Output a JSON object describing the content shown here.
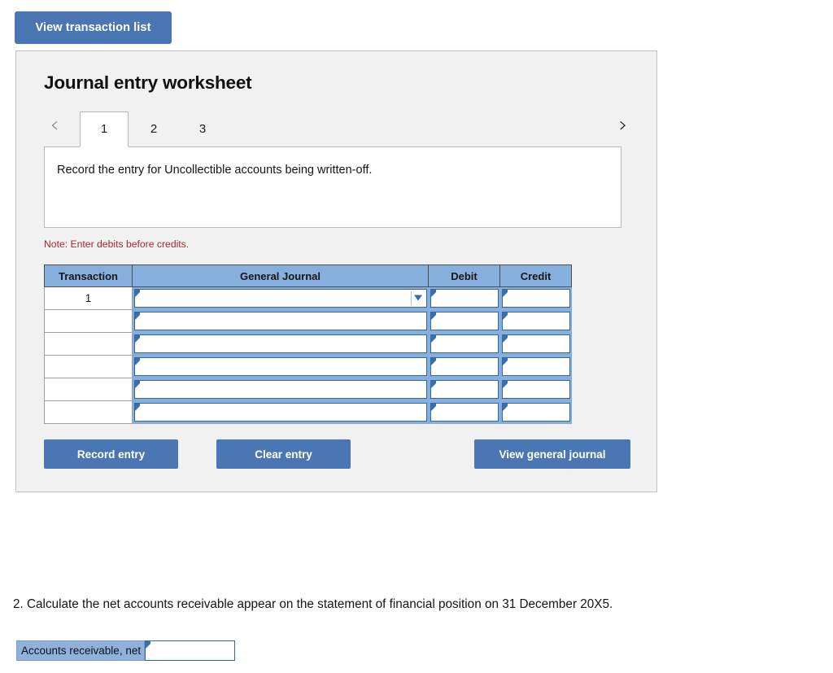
{
  "toolbar": {
    "view_transaction_list_label": "View transaction list"
  },
  "worksheet": {
    "title": "Journal entry worksheet",
    "prev_icon": "‹",
    "next_icon": "›",
    "tabs": [
      {
        "label": "1",
        "active": true
      },
      {
        "label": "2",
        "active": false
      },
      {
        "label": "3",
        "active": false
      }
    ],
    "instruction": "Record the entry for Uncollectible accounts being written-off.",
    "note": "Note: Enter debits before credits.",
    "table": {
      "headers": [
        "Transaction",
        "General Journal",
        "Debit",
        "Credit"
      ],
      "rows": [
        {
          "transaction": "1",
          "general_journal": "",
          "debit": "",
          "credit": "",
          "has_dropdown": true
        },
        {
          "transaction": "",
          "general_journal": "",
          "debit": "",
          "credit": "",
          "has_dropdown": false
        },
        {
          "transaction": "",
          "general_journal": "",
          "debit": "",
          "credit": "",
          "has_dropdown": false
        },
        {
          "transaction": "",
          "general_journal": "",
          "debit": "",
          "credit": "",
          "has_dropdown": false
        },
        {
          "transaction": "",
          "general_journal": "",
          "debit": "",
          "credit": "",
          "has_dropdown": false
        },
        {
          "transaction": "",
          "general_journal": "",
          "debit": "",
          "credit": "",
          "has_dropdown": false
        }
      ]
    },
    "actions": {
      "record_entry_label": "Record entry",
      "clear_entry_label": "Clear entry",
      "view_general_journal_label": "View general journal"
    }
  },
  "question2": {
    "text": "2. Calculate the net accounts receivable appear on the statement of financial position on 31 December 20X5.",
    "answer_label": "Accounts receivable, net",
    "answer_value": ""
  },
  "colors": {
    "button_blue": "#4a77b4",
    "header_blue": "#87afde",
    "input_border_blue": "#33679f",
    "note_red": "#a32b2b",
    "panel_bg": "#f1f1f1",
    "panel_border": "#c3c3c3"
  }
}
